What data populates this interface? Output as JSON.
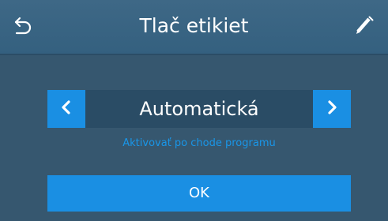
{
  "header": {
    "title": "Tlač etikiet",
    "back_icon": "back-arrow-icon",
    "edit_icon": "pencil-icon"
  },
  "selector": {
    "value": "Automatická",
    "prev_icon": "chevron-left-icon",
    "next_icon": "chevron-right-icon"
  },
  "hint": "Aktivovať po chode programu",
  "ok_label": "OK",
  "colors": {
    "background": "#36576f",
    "header": "#3e6886",
    "accent": "#1a8fe3",
    "hint_text": "#1996e8",
    "value_box": "#2a4c65"
  }
}
